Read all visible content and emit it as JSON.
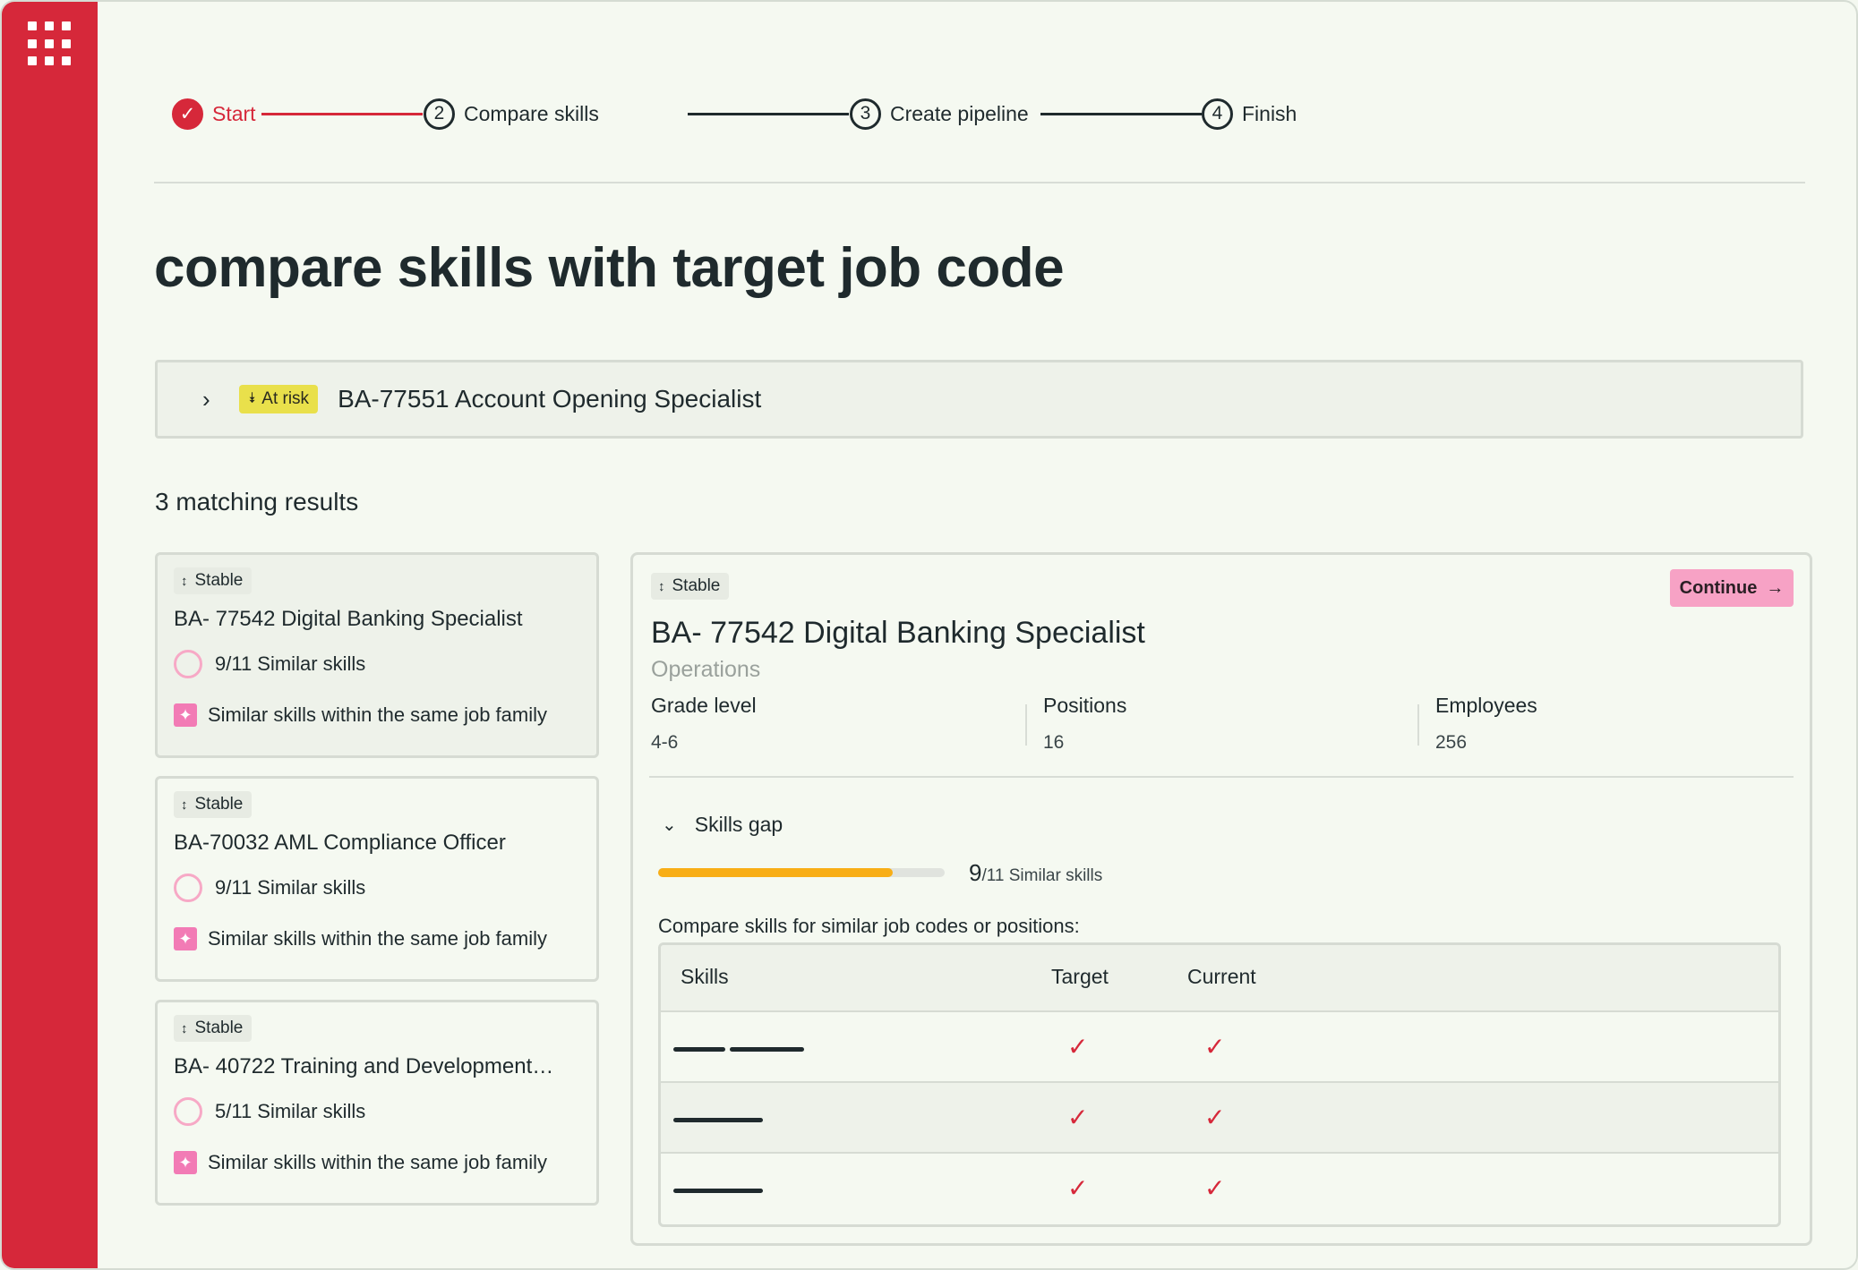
{
  "stepper": {
    "steps": [
      {
        "number": "✓",
        "label": "Start",
        "state": "done"
      },
      {
        "number": "2",
        "label": "Compare skills",
        "state": "current"
      },
      {
        "number": "3",
        "label": "Create pipeline",
        "state": "todo"
      },
      {
        "number": "4",
        "label": "Finish",
        "state": "todo"
      }
    ]
  },
  "page": {
    "title": "compare skills with target job code"
  },
  "risk_job": {
    "badge": "At risk",
    "title": "BA-77551 Account Opening Specialist"
  },
  "results": {
    "count_label": "3 matching results"
  },
  "cards": [
    {
      "badge": "Stable",
      "title": "BA- 77542 Digital Banking Specialist",
      "skills": "9/11 Similar skills",
      "family": "Similar skills within the same job family"
    },
    {
      "badge": "Stable",
      "title": "BA-70032 AML Compliance Officer",
      "skills": "9/11 Similar skills",
      "family": "Similar skills within the same job family"
    },
    {
      "badge": "Stable",
      "title": "BA- 40722 Training and Development…",
      "skills": "5/11 Similar skills",
      "family": "Similar skills within the same job family"
    }
  ],
  "detail": {
    "badge": "Stable",
    "continue_label": "Continue",
    "title": "BA- 77542 Digital Banking Specialist",
    "subtitle": "Operations",
    "stats": [
      {
        "label": "Grade level",
        "value": "4-6"
      },
      {
        "label": "Positions",
        "value": "16"
      },
      {
        "label": "Employees",
        "value": "256"
      }
    ],
    "skills_gap": {
      "label": "Skills gap",
      "matched": "9",
      "total_label": "/11 Similar skills",
      "fraction": 0.82
    },
    "compare_label": "Compare skills for similar job codes or positions:",
    "table": {
      "headers": {
        "skills": "Skills",
        "target": "Target",
        "current": "Current"
      },
      "rows": [
        {
          "target": "✓",
          "current": "✓"
        },
        {
          "target": "✓",
          "current": "✓"
        },
        {
          "target": "✓",
          "current": "✓"
        }
      ]
    }
  },
  "colors": {
    "brand": "#d6283a",
    "accent_pink": "#f7a2c5",
    "warning": "#e9e04b",
    "progress": "#f8ae16"
  },
  "icons": [
    "apps-grid-icon",
    "check-circle-icon",
    "chevron-right-icon",
    "double-chevron-down-icon",
    "sort-icon",
    "sparkle-icon",
    "arrow-right-icon",
    "chevron-down-icon",
    "checkmark-icon"
  ]
}
